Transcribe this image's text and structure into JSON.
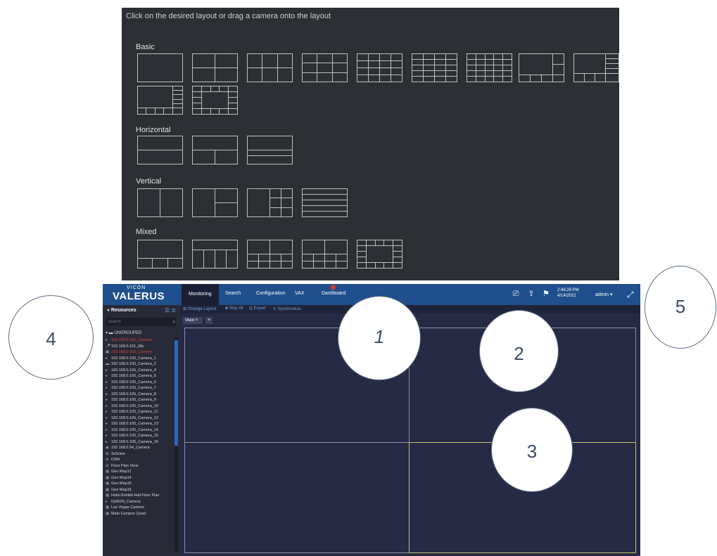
{
  "picker": {
    "instruction": "Click on the desired layout or drag a camera onto the layout",
    "sections": [
      "Basic",
      "Horizontal",
      "Vertical",
      "Mixed"
    ]
  },
  "app": {
    "logo_top": "VICON",
    "logo_main": "VALERUS",
    "nav": [
      "Monitoring",
      "Search",
      "Configuration",
      "VAX",
      "Dashboard"
    ],
    "clock_time": "2:46:29 PM",
    "clock_date": "4/14/2021",
    "user": "admin ▾",
    "icons": {
      "monitor": "monitor-icon",
      "share": "share-icon",
      "flag": "flag-icon",
      "fullscreen": "fullscreen-icon"
    },
    "resources": {
      "title": "Resources",
      "search_placeholder": "Search",
      "group": "UNGROUPED",
      "items": [
        {
          "label": "192.168.0.100_Camera",
          "icon": "▸",
          "red": true
        },
        {
          "label": "192.168.0.101_Mic",
          "icon": "🎤",
          "red": false
        },
        {
          "label": "192.168.0.102_Camera",
          "icon": "▣",
          "red": true
        },
        {
          "label": "192.168.0.105_Camera_1",
          "icon": "▸",
          "red": false
        },
        {
          "label": "192.168.0.105_Camera_2",
          "icon": "▬",
          "red": false
        },
        {
          "label": "192.168.0.105_Camera_4",
          "icon": "▸",
          "red": false
        },
        {
          "label": "192.168.0.105_Camera_5",
          "icon": "▸",
          "red": false
        },
        {
          "label": "192.168.0.105_Camera_6",
          "icon": "▸",
          "red": false
        },
        {
          "label": "192.168.0.105_Camera_7",
          "icon": "▸",
          "red": false
        },
        {
          "label": "192.168.0.105_Camera_8",
          "icon": "▸",
          "red": false
        },
        {
          "label": "192.168.0.105_Camera_9",
          "icon": "▸",
          "red": false
        },
        {
          "label": "192.168.0.105_Camera_10",
          "icon": "▸",
          "red": false
        },
        {
          "label": "192.168.0.105_Camera_11",
          "icon": "▸",
          "red": false
        },
        {
          "label": "192.168.0.105_Camera_12",
          "icon": "▸",
          "red": false
        },
        {
          "label": "192.168.0.105_Camera_13",
          "icon": "▸",
          "red": false
        },
        {
          "label": "192.168.0.105_Camera_14",
          "icon": "▸",
          "red": false
        },
        {
          "label": "192.168.0.105_Camera_15",
          "icon": "▸",
          "red": false
        },
        {
          "label": "192.168.0.105_Camera_16",
          "icon": "▸",
          "red": false
        },
        {
          "label": "192.168.0.54_Camera",
          "icon": "◉",
          "red": false
        },
        {
          "label": "3x3view",
          "icon": "⊞",
          "red": false
        },
        {
          "label": "CNN",
          "icon": "⊕",
          "red": false
        },
        {
          "label": "Floor Plan View",
          "icon": "⊞",
          "red": false
        },
        {
          "label": "Geo Map12",
          "icon": "▦",
          "red": false
        },
        {
          "label": "Geo Map14",
          "icon": "▦",
          "red": false
        },
        {
          "label": "Geo Map15",
          "icon": "▦",
          "red": false
        },
        {
          "label": "Geo Map16",
          "icon": "▦",
          "red": false
        },
        {
          "label": "Hotel Exhibit Hall Floor Plan",
          "icon": "▦",
          "red": false
        },
        {
          "label": "IQ062N_Camera",
          "icon": "▸",
          "red": false
        },
        {
          "label": "Las Vegas Casinos",
          "icon": "▦",
          "red": false
        },
        {
          "label": "Main Campus Quad",
          "icon": "▦",
          "red": false
        }
      ]
    },
    "toolbar": [
      "Change Layout",
      "Stop All",
      "Export",
      "Synchronize"
    ],
    "tabs": {
      "view": "View ×",
      "add": "+"
    }
  },
  "callouts": [
    "1",
    "2",
    "3",
    "4",
    "5"
  ]
}
